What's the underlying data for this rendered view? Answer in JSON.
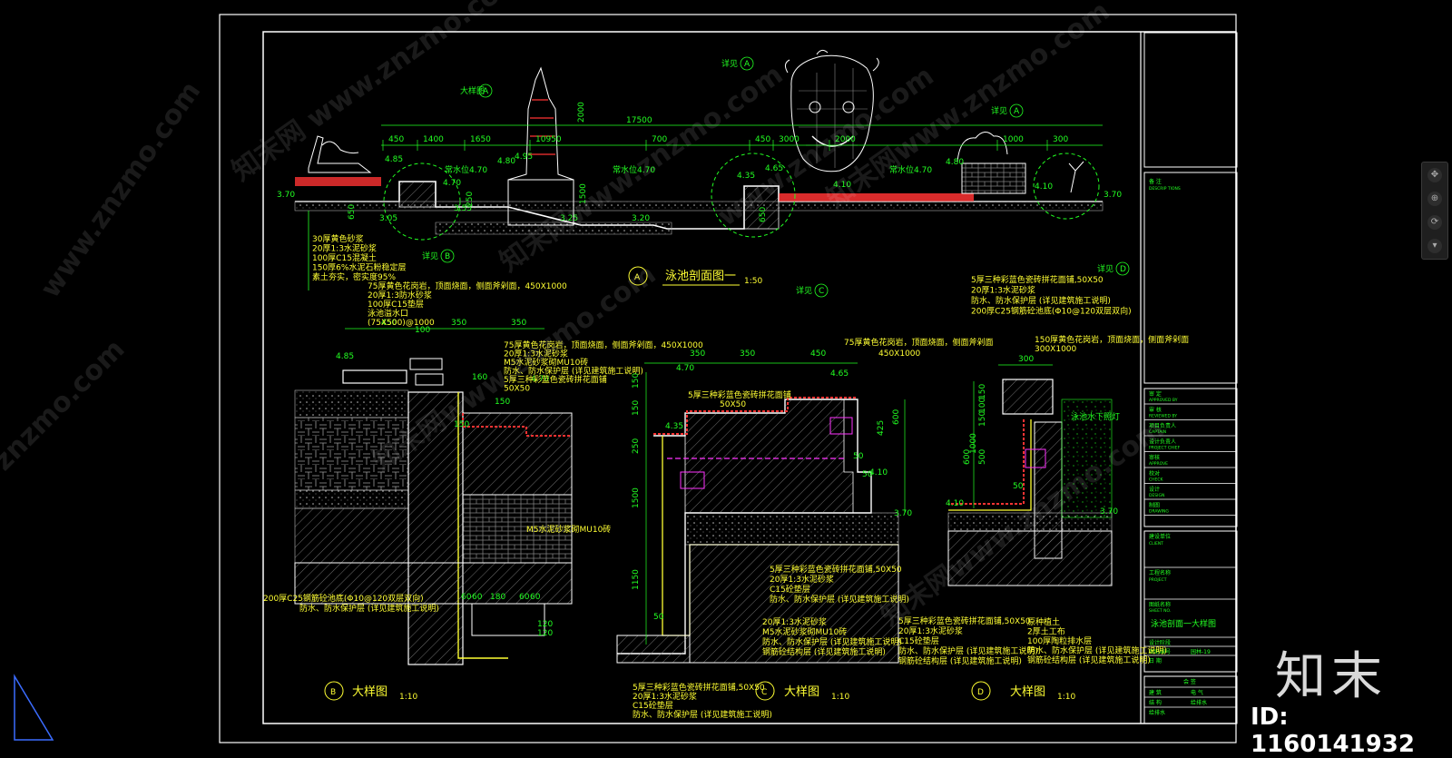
{
  "sheet": {
    "title_table": {
      "notes_label": "备 注",
      "notes_en": "DESCRIP TIONS",
      "approval_rows": [
        {
          "cn": "审 定",
          "en": "APPROVED BY"
        },
        {
          "cn": "审 核",
          "en": "REVIEWED BY"
        },
        {
          "cn": "项目负责人",
          "en": "CAPTAIN"
        },
        {
          "cn": "设计负责人",
          "en": "PROJECT CHIEF"
        },
        {
          "cn": "审核",
          "en": "APPROVE"
        },
        {
          "cn": "校对",
          "en": "CHECK"
        },
        {
          "cn": "设计",
          "en": "DESIGN"
        },
        {
          "cn": "制图",
          "en": "DRAWING"
        }
      ],
      "client_label": "建设单位",
      "client_en": "CLIENT",
      "project_label": "工程名称",
      "project_en": "PROJECT",
      "drawing_label": "图纸名称",
      "drawing_en": "SHEET NO.",
      "drawing_name": "泳池剖面一大样图",
      "sheet_rows": [
        {
          "a": "设计阶段",
          "b": ""
        },
        {
          "a": "图纸编号",
          "b": "园林-19"
        },
        {
          "a": "日 期",
          "b": ""
        }
      ],
      "sign_header": "会 签",
      "sign_rows": [
        {
          "a": "建 筑",
          "b": "电 气"
        },
        {
          "a": "结 构",
          "b": "给排水"
        },
        {
          "a": "给排水",
          "b": ""
        }
      ]
    },
    "section_A": {
      "marker": "A",
      "title": "泳池剖面图一",
      "scale": "1:50",
      "dims_top": [
        "450",
        "1400",
        "1650",
        "10950",
        "700",
        "450",
        "3000",
        "2000",
        "1000",
        "300"
      ],
      "dim_total": "17500",
      "dim_height": "2000",
      "levels": [
        "3.70",
        "4.85",
        "4.80",
        "4.95",
        "4.70",
        "4.35",
        "4.65",
        "4.10",
        "3.55",
        "3.05",
        "3.25",
        "3.20",
        "3.70",
        "4.10",
        "4.80"
      ],
      "water_labels": [
        "常水位4.70",
        "常水位4.70",
        "常水位4.70"
      ],
      "callouts": [
        {
          "letter": "A",
          "text": "大样图"
        },
        {
          "letter": "B",
          "text": "详见"
        },
        {
          "letter": "C",
          "text": "详见"
        },
        {
          "letter": "D",
          "text": "详见"
        },
        {
          "letter": "A",
          "text": "详见"
        },
        {
          "letter": "A",
          "text": "详见"
        }
      ],
      "notes": [
        "30厚黄色砂浆",
        "20厚1:3水泥砂浆",
        "100厚C15混凝土",
        "150厚6%水泥石粉稳定层",
        "素土夯实，密实度95%"
      ],
      "small_dims": [
        "250",
        "650",
        "1500",
        "650"
      ]
    },
    "detail_B": {
      "marker": "B",
      "title": "大样图",
      "scale": "1:10",
      "notes_top": [
        "75厚黄色花岗岩，顶面烧面，侧面斧剁面，450X1000",
        "20厚1:3防水砂浆",
        "100厚C15垫层",
        "泳池溢水口",
        "(75X500)@1000"
      ],
      "notes_mid": [
        "75厚黄色花岗岩，顶面烧面，侧面斧剁面，450X1000",
        "20厚1:3水泥砂浆",
        "M5水泥砂浆砌MU10砖",
        "防水、防水保护层 (详见建筑施工说明)",
        "5厚三种彩蓝色瓷砖拼花面铺",
        "50X50"
      ],
      "dims": [
        "450",
        "100",
        "350",
        "350",
        "4.85",
        "4.70",
        "150",
        "160",
        "150",
        "60",
        "60",
        "180",
        "60",
        "60",
        "120",
        "120"
      ],
      "notes_bottom": [
        "M5水泥砂浆砌MU10砖",
        "200厚C25钢筋砼池底(Φ10@120双层双向)",
        "防水、防水保护层 (详见建筑施工说明)"
      ]
    },
    "detail_C": {
      "marker": "C",
      "title": "大样图",
      "scale": "1:10",
      "notes_top": [
        "5厚三种彩蓝色瓷砖拼花面铺",
        "50X50",
        "75厚黄色花岗岩，顶面烧面，侧面斧剁面",
        "450X1000"
      ],
      "dims": [
        "350",
        "350",
        "450",
        "4.70",
        "4.65",
        "4.35",
        "4.10",
        "3.70",
        "150",
        "150",
        "250",
        "1500",
        "1150",
        "425",
        "600",
        "50",
        "50",
        "50"
      ],
      "notes_mid": [
        "5厚三种彩蓝色瓷砖拼花面铺,50X50",
        "20厚1:3水泥砂浆",
        "C15砼垫层",
        "防水、防水保护层 (详见建筑施工说明)",
        "20厚1:3水泥砂浆",
        "M5水泥砂浆砌MU10砖",
        "防水、防水保护层 (详见建筑施工说明)",
        "钢筋砼结构层 (详见建筑施工说明)"
      ],
      "notes_bottom": [
        "5厚三种彩蓝色瓷砖拼花面铺,50X50",
        "20厚1:3水泥砂浆",
        "C15砼垫层",
        "防水、防水保护层 (详见建筑施工说明)"
      ]
    },
    "detail_D": {
      "marker": "D",
      "title": "大样图",
      "scale": "1:10",
      "notes_top": [
        "5厚三种彩蓝色瓷砖拼花面铺,50X50",
        "20厚1:3水泥砂浆",
        "防水、防水保护层 (详见建筑施工说明)",
        "200厚C25钢筋砼池底(Φ10@120双层双向)",
        "150厚黄色花岗岩，顶面烧面，侧面斧剁面",
        "300X1000"
      ],
      "dims": [
        "300",
        "150",
        "100",
        "150",
        "600",
        "1000",
        "500",
        "50",
        "4.10",
        "3.70"
      ],
      "label_right": "泳池水下照灯",
      "notes_bottom": [
        "5厚三种彩蓝色瓷砖拼花面铺,50X50",
        "20厚1:3水泥砂浆",
        "C15砼垫层",
        "防水、防水保护层 (详见建筑施工说明)",
        "钢筋砼结构层 (详见建筑施工说明)",
        "原种植土",
        "2厚土工布",
        "100厚陶粒排水层",
        "防水、防水保护层 (详见建筑施工说明)",
        "钢筋砼结构层 (详见建筑施工说明)"
      ]
    }
  },
  "watermarks": [
    "www.znzmo.com",
    "知末网 www.znzmo.com",
    "知末网www.znzmo.com",
    "www.znzmo.com",
    "知末网www.znzmo.com",
    "znzmo.com",
    "知末网www.znzmo.com",
    "知末网www.znzmo.com"
  ],
  "overlay": {
    "logo_text": "知末",
    "id_text": "ID: 1160141932"
  },
  "colors": {
    "dim": "#22ff22",
    "text": "#ffff33",
    "section": "#ffffff",
    "red": "#ff3333",
    "magenta": "#ff33ff",
    "hatch": "#bbbbbb"
  }
}
